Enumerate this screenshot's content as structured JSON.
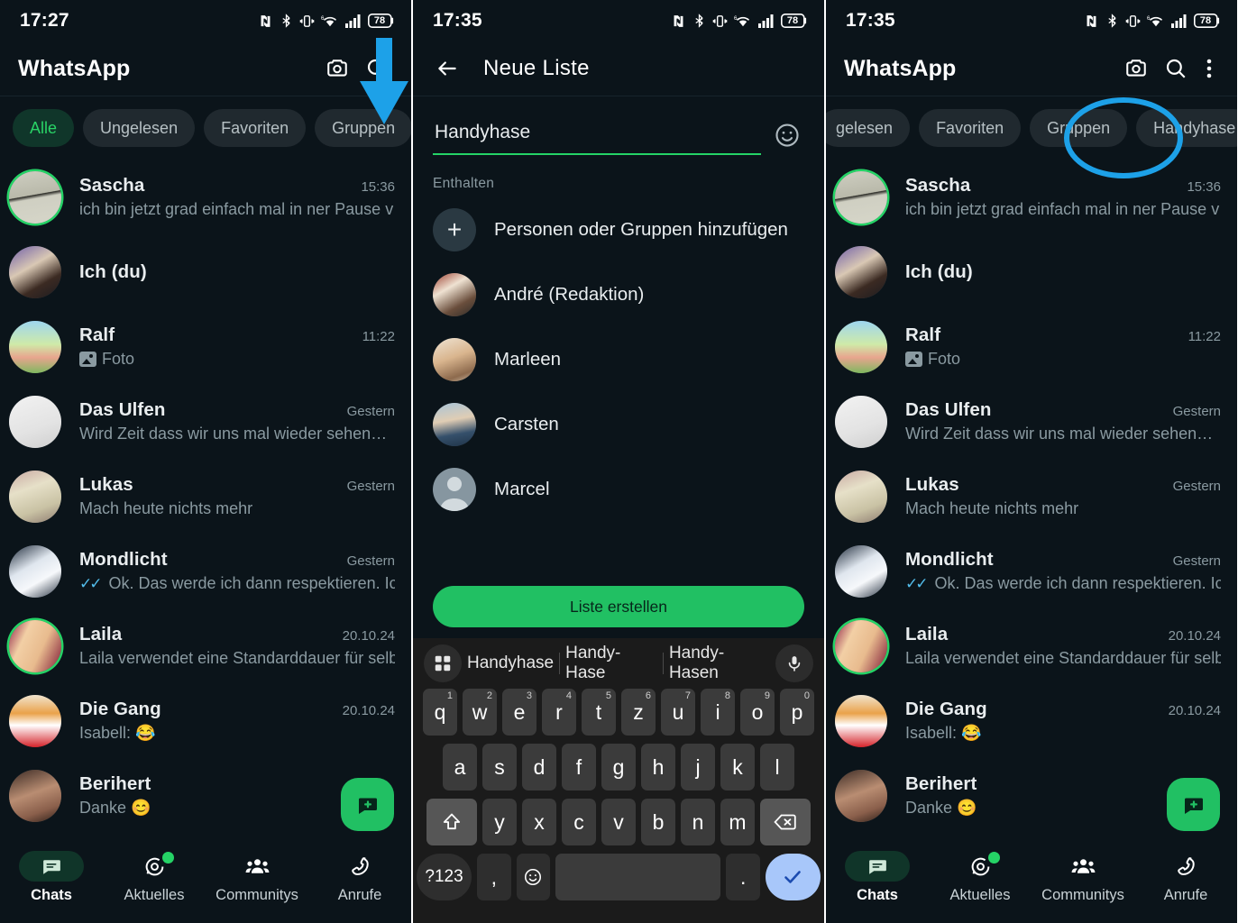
{
  "accent": {
    "whatsapp_green": "#21c063",
    "chip_active_green": "#29d366",
    "annotation_blue": "#1da1e8",
    "tick_blue": "#53bdeb",
    "bg": "#0b141a"
  },
  "panels": [
    {
      "id": "panel-chats-before",
      "status": {
        "time": "17:27",
        "battery": "78",
        "wifi_gen": "6",
        "icons": [
          "nfc-icon",
          "bluetooth-icon",
          "vibrate-icon",
          "wifi-icon",
          "signal-icon",
          "battery-icon"
        ]
      },
      "appbar": {
        "title": "WhatsApp",
        "actions": [
          "camera-icon",
          "search-icon"
        ]
      },
      "chips": [
        {
          "label": "Alle",
          "active": true
        },
        {
          "label": "Ungelesen",
          "active": false
        },
        {
          "label": "Favoriten",
          "active": false
        },
        {
          "label": "Gruppen",
          "active": false
        },
        {
          "label": "+",
          "active": false,
          "is_plus": true
        }
      ],
      "annotation": {
        "type": "arrow-down",
        "color": "#1da1e8"
      }
    },
    {
      "id": "panel-neue-liste",
      "status": {
        "time": "17:35",
        "battery": "78",
        "wifi_gen": "6"
      },
      "appbar": {
        "back": "back-arrow-icon",
        "title": "Neue Liste"
      },
      "list_name": {
        "value": "Handyhase",
        "emoji_button": "emoji-icon"
      },
      "section_label": "Enthalten",
      "members": [
        {
          "name": "Personen oder Gruppen hinzufügen",
          "avatar": "plus"
        },
        {
          "name": "André (Redaktion)",
          "avatar": "photo-andre"
        },
        {
          "name": "Marleen",
          "avatar": "photo-marleen"
        },
        {
          "name": "Carsten",
          "avatar": "photo-carsten"
        },
        {
          "name": "Marcel",
          "avatar": "placeholder"
        }
      ],
      "create_button": "Liste erstellen",
      "keyboard": {
        "suggestions": [
          "Handyhase",
          "Handy-Hase",
          "Handy-Hasen"
        ],
        "row1": [
          {
            "k": "q",
            "n": "1"
          },
          {
            "k": "w",
            "n": "2"
          },
          {
            "k": "e",
            "n": "3"
          },
          {
            "k": "r",
            "n": "4"
          },
          {
            "k": "t",
            "n": "5"
          },
          {
            "k": "z",
            "n": "6"
          },
          {
            "k": "u",
            "n": "7"
          },
          {
            "k": "i",
            "n": "8"
          },
          {
            "k": "o",
            "n": "9"
          },
          {
            "k": "p",
            "n": "0"
          }
        ],
        "row2": [
          "a",
          "s",
          "d",
          "f",
          "g",
          "h",
          "j",
          "k",
          "l"
        ],
        "row3": [
          "y",
          "x",
          "c",
          "v",
          "b",
          "n",
          "m"
        ],
        "shift": "shift-icon",
        "backspace": "backspace-icon",
        "symbols": "?123",
        "comma": ",",
        "emoji": "emoji-icon",
        "period": ".",
        "enter": "check-icon",
        "mic": "mic-icon",
        "grid": "grid-icon"
      }
    },
    {
      "id": "panel-chats-after",
      "status": {
        "time": "17:35",
        "battery": "78",
        "wifi_gen": "6"
      },
      "appbar": {
        "title": "WhatsApp",
        "actions": [
          "camera-icon",
          "search-icon",
          "overflow-menu-icon"
        ]
      },
      "chips": [
        {
          "label": "gelesen",
          "active": false,
          "clipped": true
        },
        {
          "label": "Favoriten",
          "active": false
        },
        {
          "label": "Gruppen",
          "active": false
        },
        {
          "label": "Handyhase",
          "active": false,
          "highlighted": true
        },
        {
          "label": "+",
          "active": false,
          "is_plus": true
        }
      ],
      "annotation": {
        "type": "ellipse",
        "color": "#1da1e8"
      }
    }
  ],
  "chats": [
    {
      "name": "Sascha",
      "time": "15:36",
      "message": "ich bin jetzt grad einfach mal in ner Pause v…",
      "ring": true,
      "ticks": false,
      "photo": false,
      "avatar": "sascha"
    },
    {
      "name": "Ich (du)",
      "time": "",
      "message": "",
      "ring": false,
      "ticks": false,
      "photo": false,
      "avatar": "ichdu"
    },
    {
      "name": "Ralf",
      "time": "11:22",
      "message": "Foto",
      "ring": false,
      "ticks": false,
      "photo": true,
      "avatar": "ralf"
    },
    {
      "name": "Das Ulfen",
      "time": "Gestern",
      "message": "Wird Zeit dass wir uns mal wieder sehen…",
      "ring": false,
      "ticks": false,
      "photo": false,
      "avatar": "ulfen"
    },
    {
      "name": "Lukas",
      "time": "Gestern",
      "message": "Mach heute nichts mehr",
      "ring": false,
      "ticks": false,
      "photo": false,
      "avatar": "lukas"
    },
    {
      "name": "Mondlicht",
      "time": "Gestern",
      "message": "Ok. Das werde ich dann respektieren. Ich…",
      "ring": false,
      "ticks": true,
      "photo": false,
      "avatar": "mondlicht"
    },
    {
      "name": "Laila",
      "time": "20.10.24",
      "message": "Laila verwendet eine Standarddauer für selb…",
      "ring": true,
      "ticks": false,
      "photo": false,
      "avatar": "laila"
    },
    {
      "name": "Die Gang",
      "time": "20.10.24",
      "message": "Isabell: 😂",
      "ring": false,
      "ticks": false,
      "photo": false,
      "avatar": "diegang"
    },
    {
      "name": "Berihert",
      "time": "",
      "message": "Danke 😊",
      "ring": false,
      "ticks": false,
      "photo": false,
      "avatar": "berihert"
    }
  ],
  "bottom_nav": [
    {
      "label": "Chats",
      "icon": "chats-icon",
      "active": true,
      "badge": false
    },
    {
      "label": "Aktuelles",
      "icon": "status-icon",
      "active": false,
      "badge": true
    },
    {
      "label": "Communitys",
      "icon": "communities-icon",
      "active": false,
      "badge": false
    },
    {
      "label": "Anrufe",
      "icon": "calls-icon",
      "active": false,
      "badge": false
    }
  ],
  "fab": {
    "icon": "new-chat-icon"
  }
}
